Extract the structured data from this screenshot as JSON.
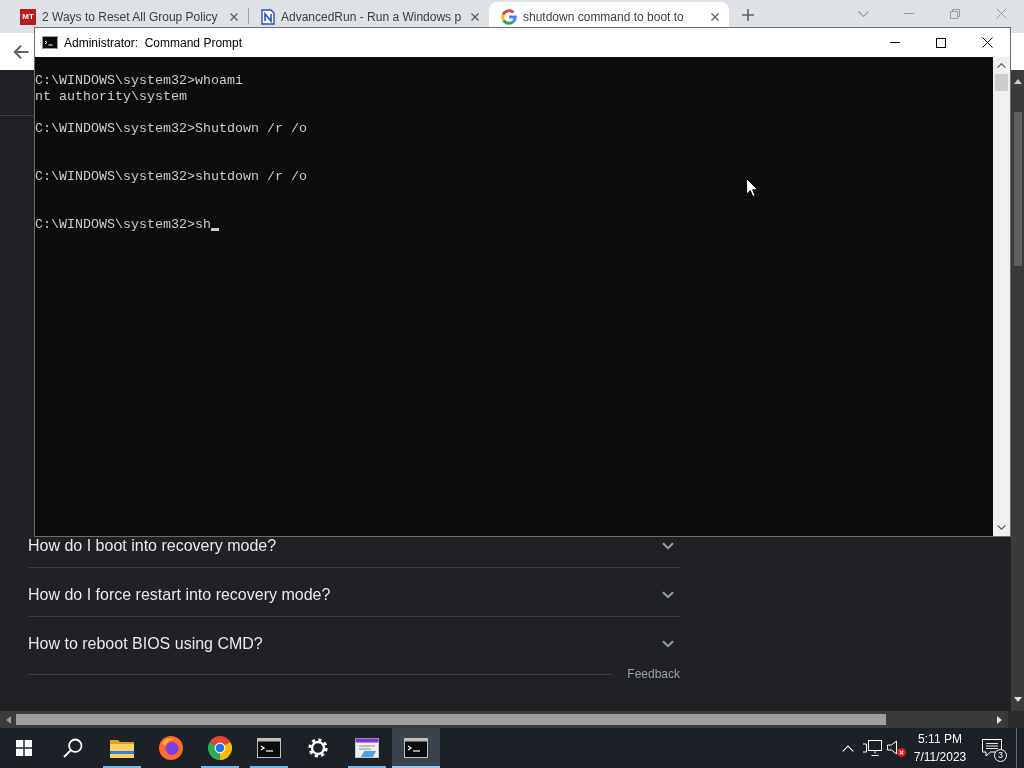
{
  "browser": {
    "tabs": [
      {
        "kind": "letters",
        "favicon_text": "MT",
        "title": "2 Ways to Reset All Group Policy",
        "selected": false
      },
      {
        "kind": "document",
        "title": "AdvancedRun - Run a Windows p",
        "selected": false
      },
      {
        "kind": "google",
        "title": "shutdown command to boot to",
        "selected": true
      }
    ],
    "page": {
      "faq": [
        {
          "question": "How do I boot into recovery mode?",
          "expanded": false
        },
        {
          "question": "How do I force restart into recovery mode?",
          "expanded": false
        },
        {
          "question": "How to reboot BIOS using CMD?",
          "expanded": false
        }
      ],
      "feedback": "Feedback"
    }
  },
  "console_window": {
    "title": "Administrator:  Command Prompt",
    "output": "C:\\WINDOWS\\system32>whoami\nnt authority\\system\n\nC:\\WINDOWS\\system32>Shutdown /r /o\n\n\nC:\\WINDOWS\\system32>shutdown /r /o\n\n\nC:\\WINDOWS\\system32>sh",
    "cursor": true
  },
  "taskbar": {
    "apps": [
      {
        "kind": "start",
        "running": false,
        "active": false
      },
      {
        "kind": "search",
        "running": false,
        "active": false
      },
      {
        "kind": "file-explorer",
        "running": true,
        "active": false
      },
      {
        "kind": "firefox",
        "running": false,
        "active": false
      },
      {
        "kind": "chrome",
        "running": true,
        "active": false
      },
      {
        "kind": "terminal",
        "running": true,
        "active": false
      },
      {
        "kind": "settings",
        "running": false,
        "active": false
      },
      {
        "kind": "form-app",
        "running": true,
        "active": false
      },
      {
        "kind": "terminal",
        "running": true,
        "active": true
      }
    ],
    "clock": {
      "time": "5:11 PM",
      "date": "7/11/2023"
    },
    "notification_count": "3"
  }
}
